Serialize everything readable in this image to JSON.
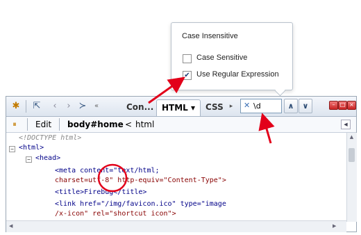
{
  "popup": {
    "title": "Case Insensitive",
    "options": [
      {
        "label": "Case Sensitive",
        "checked": false
      },
      {
        "label": "Use Regular Expression",
        "checked": true
      }
    ]
  },
  "toolbar": {
    "tabs": [
      "Con...",
      "HTML ▾",
      "CSS"
    ],
    "search_value": "\\d",
    "clear_glyph": "✕",
    "prev_glyph": "∧",
    "next_glyph": "∨"
  },
  "subbar": {
    "edit_label": "Edit",
    "crumb_current": "body#home",
    "crumb_sep": "<",
    "crumb_parent": "html"
  },
  "html_view": {
    "doctype": "<!DOCTYPE html>",
    "html_open": "<html>",
    "head_open": "<head>",
    "meta_line1": "<meta content=\"text/html;",
    "meta_line2": "charset=utf-8\" http-equiv=\"Content-Type\">",
    "title_line": "<title>Firebug</title>",
    "link_line1": "<link href=\"/img/favicon.ico\" type=\"image",
    "link_line2": "/x-icon\" rel=\"shortcut icon\">"
  },
  "colors": {
    "arrow": "#e2001a",
    "highlight_circle": "#e2001a"
  }
}
